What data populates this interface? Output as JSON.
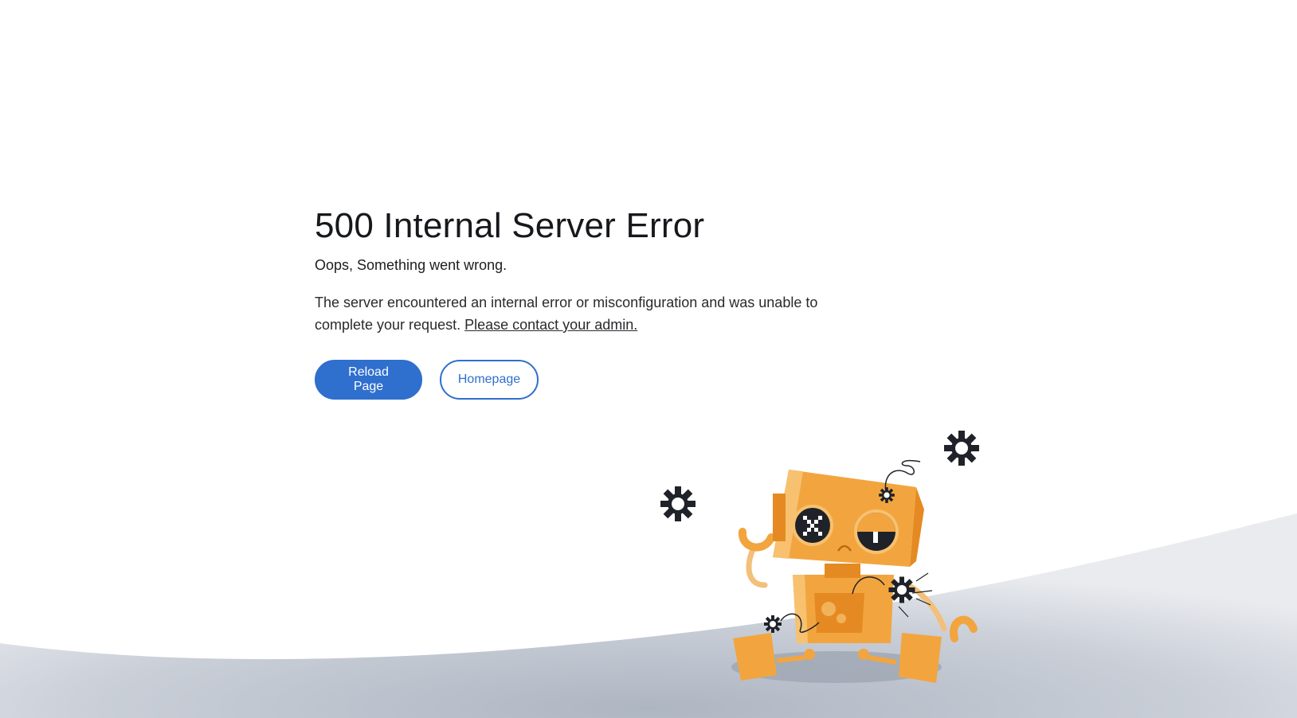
{
  "error": {
    "title": "500 Internal Server Error",
    "subtitle": "Oops, Something went wrong.",
    "message": "The server encountered an internal error or misconfiguration and was unable to complete your request.",
    "contact_link": "Please contact your admin."
  },
  "actions": {
    "reload_label": "Reload Page",
    "home_label": "Homepage"
  },
  "theme": {
    "accent": "#2f6fce",
    "robot_body": "#f2a53f",
    "robot_shadow": "#e58a22",
    "ground": "#b9c0cb"
  },
  "illustration": {
    "subject": "broken-robot",
    "icons": [
      "gear-icon",
      "gear-icon",
      "gear-icon",
      "gear-icon"
    ]
  }
}
